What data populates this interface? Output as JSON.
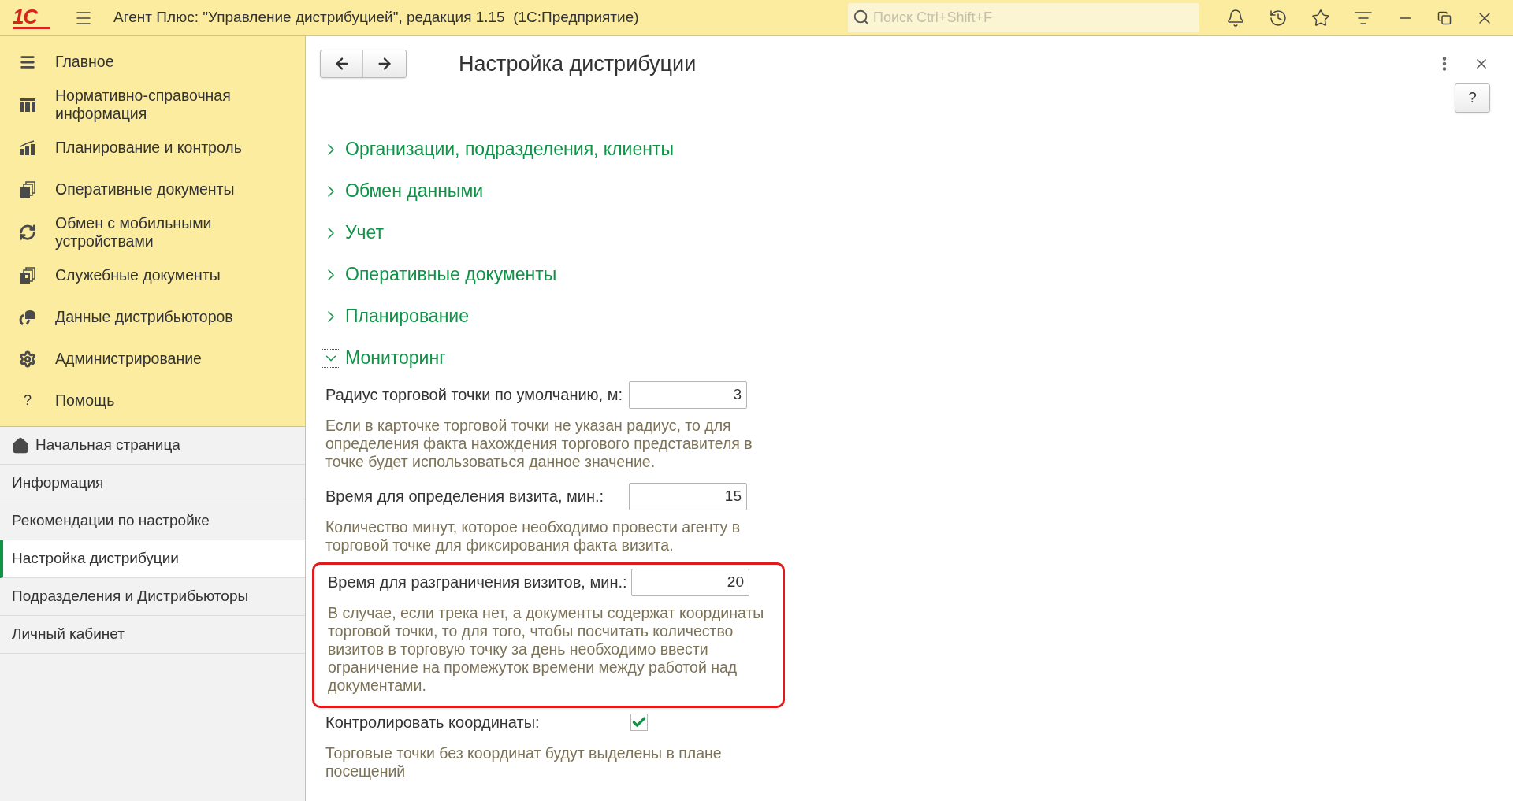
{
  "window": {
    "title": "Агент Плюс: \"Управление дистрибуцией\", редакция 1.15  (1С:Предприятие)",
    "logo": "1С",
    "search": {
      "placeholder": "Поиск Ctrl+Shift+F"
    }
  },
  "sidebar": {
    "items": [
      {
        "label": "Главное",
        "kind": "menu"
      },
      {
        "label": "Нормативно-справочная информация",
        "kind": "catalog"
      },
      {
        "label": "Планирование и контроль",
        "kind": "chart"
      },
      {
        "label": "Оперативные документы",
        "kind": "docs"
      },
      {
        "label": "Обмен с мобильными устройствами",
        "kind": "sync"
      },
      {
        "label": "Служебные документы",
        "kind": "servicedocs"
      },
      {
        "label": "Данные дистрибьюторов",
        "kind": "data"
      },
      {
        "label": "Администрирование",
        "kind": "gear"
      },
      {
        "label": "Помощь",
        "kind": "help",
        "glyph": "?"
      }
    ],
    "sections": [
      {
        "label": "Начальная страница",
        "home": true,
        "selected": false
      },
      {
        "label": "Информация",
        "home": false,
        "selected": false
      },
      {
        "label": "Рекомендации по настройке",
        "home": false,
        "selected": false
      },
      {
        "label": "Настройка дистрибуции",
        "home": false,
        "selected": true
      },
      {
        "label": "Подразделения и Дистрибьюторы",
        "home": false,
        "selected": false
      },
      {
        "label": "Личный кабинет",
        "home": false,
        "selected": false
      }
    ]
  },
  "form": {
    "title": "Настройка дистрибуции",
    "help_button": "?",
    "groups": [
      {
        "label": "Организации, подразделения, клиенты",
        "expanded": false
      },
      {
        "label": "Обмен данными",
        "expanded": false
      },
      {
        "label": "Учет",
        "expanded": false
      },
      {
        "label": "Оперативные документы",
        "expanded": false
      },
      {
        "label": "Планирование",
        "expanded": false
      },
      {
        "label": "Мониторинг",
        "expanded": true,
        "fields": [
          {
            "kind": "number",
            "label": "Радиус торговой точки по умолчанию, м:",
            "value": "3",
            "help": "Если в карточке торговой точки не указан радиус, то для определения факта нахождения торгового представителя в точке будет использоваться данное значение.",
            "highlighted": false
          },
          {
            "kind": "number",
            "label": "Время для определения визита, мин.:",
            "value": "15",
            "help": "Количество минут, которое необходимо провести агенту в торговой точке для фиксирования факта визита.",
            "highlighted": false
          },
          {
            "kind": "number",
            "label": "Время для разграничения визитов, мин.:",
            "value": "20",
            "help": "В случае, если трека нет, а документы содержат координаты торговой точки, то для того, чтобы посчитать количество визитов в торговую точку за день необходимо ввести ограничение на промежуток времени между работой над документами.",
            "highlighted": true
          },
          {
            "kind": "checkbox",
            "label": "Контролировать координаты:",
            "checked": true,
            "help": "Торговые точки без координат будут выделены в плане посещений",
            "highlighted": false
          }
        ]
      }
    ]
  }
}
